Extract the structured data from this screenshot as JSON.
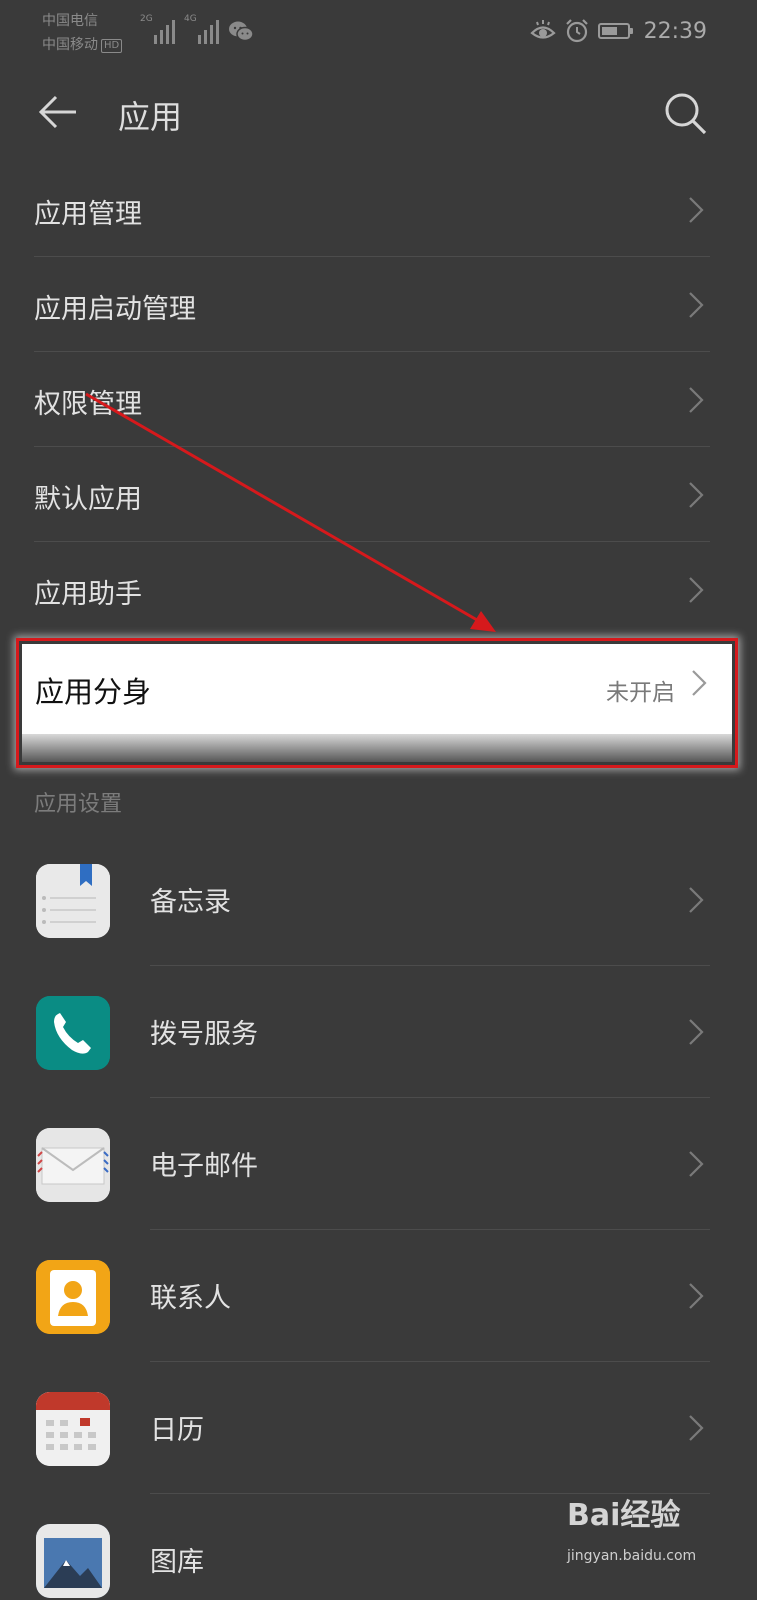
{
  "status_bar": {
    "carrier_1": "中国电信",
    "carrier_2": "中国移动",
    "hd_badge": "HD",
    "signal_1_tag": "2G",
    "signal_2_tag": "4G",
    "time": "22:39",
    "battery_level": 0.55
  },
  "header": {
    "title": "应用",
    "back_icon": "arrow-left-icon",
    "search_icon": "search-icon"
  },
  "menu": [
    {
      "label": "应用管理"
    },
    {
      "label": "应用启动管理"
    },
    {
      "label": "权限管理"
    },
    {
      "label": "默认应用"
    },
    {
      "label": "应用助手"
    }
  ],
  "highlighted_item": {
    "label": "应用分身",
    "value": "未开启"
  },
  "section": {
    "title": "应用设置"
  },
  "apps": [
    {
      "label": "备忘录",
      "icon": "notepad-icon",
      "color": "#e9e9e9"
    },
    {
      "label": "拨号服务",
      "icon": "phone-icon",
      "color": "#0a8c84"
    },
    {
      "label": "电子邮件",
      "icon": "mail-icon",
      "color": "#e6e6e6"
    },
    {
      "label": "联系人",
      "icon": "contact-icon",
      "color": "#f2a516"
    },
    {
      "label": "日历",
      "icon": "calendar-icon",
      "color": "#f0f0f0"
    },
    {
      "label": "图库",
      "icon": "gallery-icon",
      "color": "#5a7da8"
    }
  ],
  "annotation": {
    "color": "#d6191c"
  },
  "watermark": {
    "logo": "Bai经验",
    "url": "jingyan.baidu.com"
  }
}
